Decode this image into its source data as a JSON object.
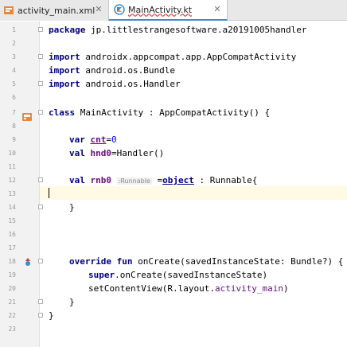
{
  "tabs": [
    {
      "label": "activity_main.xml",
      "icon": "xml-layout-icon",
      "active": false
    },
    {
      "label": "MainActivity.kt",
      "icon": "kotlin-file-icon",
      "active": true
    }
  ],
  "colors": {
    "keyword": "#000080",
    "field": "#660e7a",
    "number": "#0000ff",
    "hint": "#8a8a8a",
    "caret_line": "#fffae3"
  },
  "lines": [
    {
      "n": "1",
      "text": "package jp.littlestrangesoftware.a20191005handler"
    },
    {
      "n": "2",
      "text": ""
    },
    {
      "n": "3",
      "text": "import androidx.appcompat.app.AppCompatActivity"
    },
    {
      "n": "4",
      "text": "import android.os.Bundle"
    },
    {
      "n": "5",
      "text": "import android.os.Handler"
    },
    {
      "n": "6",
      "text": ""
    },
    {
      "n": "7",
      "text": "class MainActivity : AppCompatActivity() {"
    },
    {
      "n": "8",
      "text": ""
    },
    {
      "n": "9",
      "text": "    var cnt=0"
    },
    {
      "n": "10",
      "text": "    val hnd0=Handler()"
    },
    {
      "n": "11",
      "text": ""
    },
    {
      "n": "12",
      "text": "    val rnb0 :Runnable =object : Runnable{"
    },
    {
      "n": "13",
      "text": ""
    },
    {
      "n": "14",
      "text": "    }"
    },
    {
      "n": "15",
      "text": ""
    },
    {
      "n": "16",
      "text": ""
    },
    {
      "n": "17",
      "text": ""
    },
    {
      "n": "18",
      "text": "    override fun onCreate(savedInstanceState: Bundle?) {"
    },
    {
      "n": "19",
      "text": "        super.onCreate(savedInstanceState)"
    },
    {
      "n": "20",
      "text": "        setContentView(R.layout.activity_main)"
    },
    {
      "n": "21",
      "text": "    }"
    },
    {
      "n": "22",
      "text": "}"
    },
    {
      "n": "23",
      "text": ""
    }
  ],
  "code": {
    "l1_kw": "package",
    "l1_rest": " jp.littlestrangesoftware.a20191005handler",
    "l3_kw": "import",
    "l3_rest": " androidx.appcompat.app.AppCompatActivity",
    "l4_kw": "import",
    "l4_rest": " android.os.Bundle",
    "l5_kw": "import",
    "l5_rest": " android.os.Handler",
    "l7_kw": "class",
    "l7_rest": " MainActivity : AppCompatActivity() {",
    "l9_kw": "var",
    "l9_sp": " ",
    "l9_name": "cnt",
    "l9_eq": "=",
    "l9_val": "0",
    "l10_kw": "val",
    "l10_sp": " ",
    "l10_name": "hnd0",
    "l10_rest": "=Handler()",
    "l12_kw": "val",
    "l12_sp": " ",
    "l12_name": "rnb0",
    "l12_hint": ":Runnable",
    "l12_eq": " =",
    "l12_obj": "object",
    "l12_rest": " : Runnable{",
    "l14_text": "}",
    "l18_kw": "override fun",
    "l18_rest": " onCreate(savedInstanceState: Bundle?) {",
    "l19_kw": "super",
    "l19_rest": ".onCreate(savedInstanceState)",
    "l20_pre": "setContentView(R.layout.",
    "l20_res": "activity_main",
    "l20_post": ")",
    "l21_text": "}",
    "l22_text": "}"
  }
}
